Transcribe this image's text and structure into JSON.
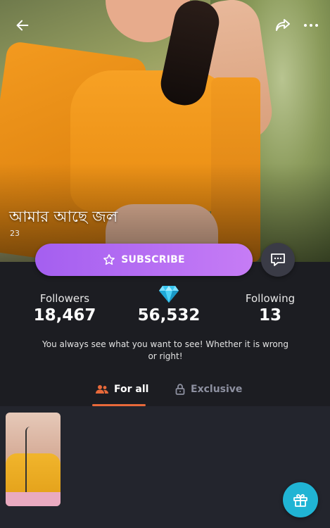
{
  "profile": {
    "name": "আমার আছে জল",
    "sub_count": "23"
  },
  "actions": {
    "subscribe_label": "SUBSCRIBE"
  },
  "stats": {
    "followers_label": "Followers",
    "followers_value": "18,467",
    "diamonds_value": "56,532",
    "following_label": "Following",
    "following_value": "13"
  },
  "bio": "You always see what you want to see! Whether it is wrong or right!",
  "tabs": [
    {
      "label": "For all",
      "icon": "users-icon",
      "active": true
    },
    {
      "label": "Exclusive",
      "icon": "lock-icon",
      "active": false
    }
  ],
  "colors": {
    "accent_purple": "#a45ff0",
    "tab_underline": "#e8693a",
    "gift_button": "#20b4d4",
    "background": "#1c1d22"
  },
  "icons": {
    "back": "arrow-left-icon",
    "share": "share-icon",
    "more": "more-dots-icon",
    "subscribe": "star-icon",
    "message": "chat-icon",
    "diamond": "diamond-icon",
    "gift": "gift-icon"
  }
}
